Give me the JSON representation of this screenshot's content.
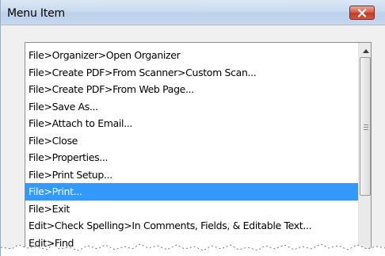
{
  "window": {
    "title": "Menu Item",
    "close_icon": "close-x-icon"
  },
  "list": {
    "items": [
      "File>Organizer>Open Organizer",
      "File>Create PDF>From Scanner>Custom Scan...",
      "File>Create PDF>From Web Page...",
      "File>Save As...",
      "File>Attach to Email...",
      "File>Close",
      "File>Properties...",
      "File>Print Setup...",
      "File>Print...",
      "File>Exit",
      "Edit>Check Spelling>In Comments, Fields, & Editable Text...",
      "Edit>Find"
    ],
    "selected_index": 8,
    "selected_color": "#3399ff"
  },
  "scrollbar": {
    "up_icon": "scroll-up-arrow-icon",
    "grip_icon": "scroll-grip-icon"
  }
}
